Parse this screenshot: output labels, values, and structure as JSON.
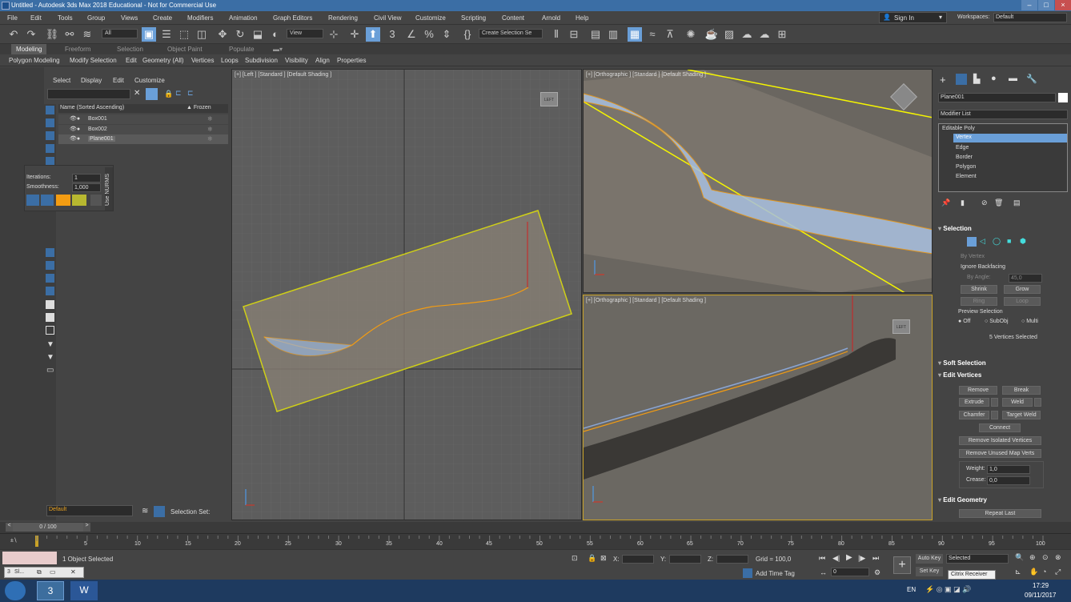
{
  "window": {
    "title": "Untitled - Autodesk 3ds Max 2018 Educational - Not for Commercial Use"
  },
  "menu": [
    "File",
    "Edit",
    "Tools",
    "Group",
    "Views",
    "Create",
    "Modifiers",
    "Animation",
    "Graph Editors",
    "Rendering",
    "Civil View",
    "Customize",
    "Scripting",
    "Content",
    "Arnold",
    "Help"
  ],
  "account": {
    "sign_in": "Sign In",
    "workspaces_label": "Workspaces:",
    "workspace": "Default"
  },
  "toolbar": {
    "filter": "All",
    "view": "View",
    "selection_set": "Create Selection Se"
  },
  "ribbon_tabs": [
    "Modeling",
    "Freeform",
    "Selection",
    "Object Paint",
    "Populate"
  ],
  "ribbon_items": [
    "Polygon Modeling",
    "Modify Selection",
    "Edit",
    "Geometry (All)",
    "Vertices",
    "Loops",
    "Subdivision",
    "Visibility",
    "Align",
    "Properties"
  ],
  "scene_explorer": {
    "menu": [
      "Select",
      "Display",
      "Edit",
      "Customize"
    ],
    "col_name": "Name (Sorted Ascending)",
    "col_frozen": "▲ Frozen",
    "items": [
      "Box001",
      "Box002",
      "Plane001"
    ],
    "layer": "Default",
    "selection_set": "Selection Set:"
  },
  "nurms": {
    "iterations_label": "Iterations:",
    "iterations": "1",
    "smoothness_label": "Smoothness:",
    "smoothness": "1,000",
    "use_nurms": "Use NURMS"
  },
  "viewports": {
    "left": "[+] [Left ] [Standard ] [Default Shading ]",
    "ortho1": "[+] [Orthographic ] [Standard ] [Default Shading ]",
    "ortho2": "[+] [Orthographic ] [Standard ] [Default Shading ]",
    "cube_left": "LEFT",
    "cube_ortho": "LEFT"
  },
  "command_panel": {
    "object_name": "Plane001",
    "modifier_list": "Modifier List",
    "stack": [
      "Editable Poly",
      "Vertex",
      "Edge",
      "Border",
      "Polygon",
      "Element"
    ],
    "selection": {
      "title": "Selection",
      "by_vertex": "By Vertex",
      "ignore_backfacing": "Ignore Backfacing",
      "by_angle": "By Angle:",
      "angle": "45,0",
      "shrink": "Shrink",
      "grow": "Grow",
      "ring": "Ring",
      "loop": "Loop",
      "preview": "Preview Selection",
      "off": "Off",
      "subobj": "SubObj",
      "multi": "Multi",
      "status": "5 Vertices Selected"
    },
    "soft_selection": "Soft Selection",
    "edit_vertices": {
      "title": "Edit Vertices",
      "remove": "Remove",
      "break": "Break",
      "extrude": "Extrude",
      "weld": "Weld",
      "chamfer": "Chamfer",
      "target_weld": "Target Weld",
      "connect": "Connect",
      "remove_isolated": "Remove Isolated Vertices",
      "remove_unused": "Remove Unused Map Verts",
      "weight_label": "Weight:",
      "weight": "1,0",
      "crease_label": "Crease:",
      "crease": "0,0"
    },
    "edit_geometry": {
      "title": "Edit Geometry",
      "repeat_last": "Repeat Last"
    }
  },
  "timeline": {
    "frame": "0 / 100",
    "ticks": [
      "5",
      "10",
      "15",
      "20",
      "25",
      "30",
      "35",
      "40",
      "45",
      "50",
      "55",
      "60",
      "65",
      "70",
      "75",
      "80",
      "85",
      "90",
      "95",
      "100"
    ]
  },
  "status": {
    "selected": "1 Object Selected",
    "x_label": "X:",
    "y_label": "Y:",
    "z_label": "Z:",
    "grid": "Grid = 100,0",
    "add_time_tag": "Add Time Tag",
    "auto_key": "Auto Key",
    "set_key": "Set Key",
    "key_filter": "Selected",
    "frame_field": "0",
    "tooltip": "Citrix Receiver",
    "task_label": "Sl..."
  },
  "taskbar": {
    "lang": "EN",
    "time": "17:29",
    "date": "09/11/2017"
  }
}
